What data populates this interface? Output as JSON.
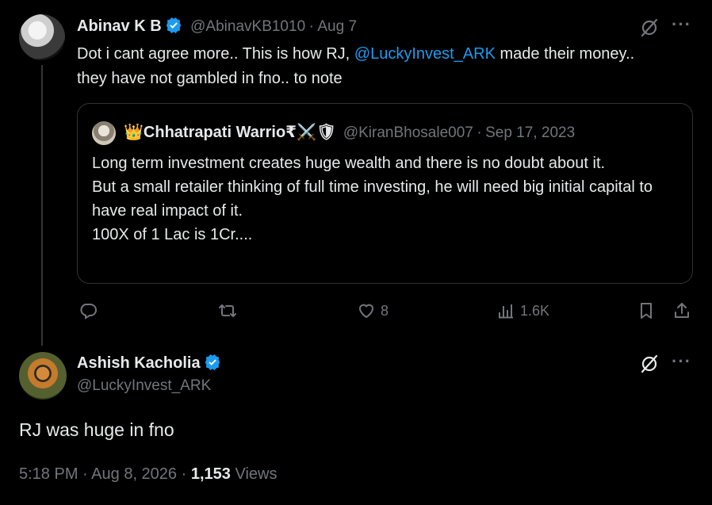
{
  "tweet1": {
    "name": "Abinav K B",
    "handle": "@AbinavKB1010",
    "date_sep": "·",
    "date": "Aug 7",
    "text_part1": "Dot i cant agree more.. This is how RJ, ",
    "mention": "@LuckyInvest_ARK",
    "text_part2": " made their money.. they have not gambled in fno.. to note",
    "quote": {
      "name": "👑Chhatrapati Warrio₹⚔️🛡",
      "handle": "@KiranBhosale007",
      "date_sep": "·",
      "date": "Sep 17, 2023",
      "lines": [
        "Long term investment creates huge wealth and there is no doubt about it.",
        "But a small retailer thinking of full time investing, he will need big initial capital to have real impact of it.",
        "100X of 1 Lac is 1Cr...."
      ]
    },
    "actions": {
      "likes": "8",
      "views": "1.6K"
    }
  },
  "tweet2": {
    "name": "Ashish Kacholia",
    "handle": "@LuckyInvest_ARK",
    "text": "RJ was huge in fno",
    "time": "5:18 PM",
    "sep1": "·",
    "date": "Aug 8, 2026",
    "sep2": "·",
    "views_count": "1,153",
    "views_label": "Views"
  },
  "colors": {
    "background": "#000000",
    "text": "#e7e9ea",
    "secondary": "#71767b",
    "accent": "#1d9bf0",
    "border": "#2f3336"
  },
  "icons": [
    "verified-badge-icon",
    "grok-icon",
    "more-icon",
    "reply-icon",
    "retweet-icon",
    "like-icon",
    "views-icon",
    "bookmark-icon",
    "share-icon"
  ]
}
